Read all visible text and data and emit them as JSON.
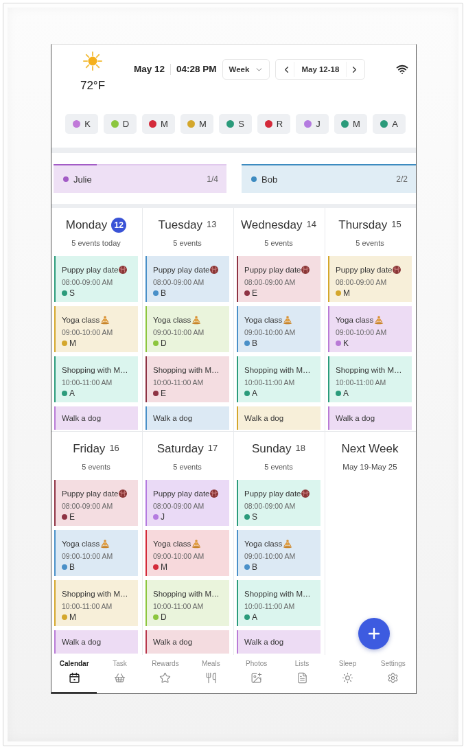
{
  "header": {
    "temperature": "72°F",
    "date": "May 12",
    "time": "04:28 PM",
    "view": "Week",
    "range": "May 12-18"
  },
  "members": [
    {
      "initial": "K",
      "color": "#c17ad9"
    },
    {
      "initial": "D",
      "color": "#8cc63e"
    },
    {
      "initial": "M",
      "color": "#d42a3a"
    },
    {
      "initial": "M",
      "color": "#d4a72c"
    },
    {
      "initial": "S",
      "color": "#2b9b7b"
    },
    {
      "initial": "R",
      "color": "#d42a3a"
    },
    {
      "initial": "J",
      "color": "#b47be0"
    },
    {
      "initial": "M",
      "color": "#2b9b7b"
    },
    {
      "initial": "A",
      "color": "#2b9b7b"
    }
  ],
  "tasks": [
    {
      "name": "Julie",
      "color": "#a35cc6",
      "count": "1/4",
      "level": 0.25
    },
    {
      "name": "Bob",
      "color": "#3d8bc0",
      "count": "2/2",
      "level": 1
    }
  ],
  "days": [
    {
      "name": "Monday",
      "date": "12",
      "selected": true,
      "summary": "5 events today",
      "events": [
        {
          "kind": "playdate",
          "title": "Puppy play date",
          "time": "08:00-09:00 AM",
          "member": "S",
          "color": "#2b9b7b"
        },
        {
          "kind": "yoga",
          "title": "Yoga class",
          "time": "09:00-10:00 AM",
          "member": "M",
          "color": "#d4a72c"
        },
        {
          "kind": "errand",
          "title": "Shopping with M…",
          "time": "10:00-11:00 AM",
          "member": "A",
          "color": "#2b9b7b"
        },
        {
          "kind": "walk",
          "title": "Walk a dog",
          "color": "#b97bd6"
        }
      ]
    },
    {
      "name": "Tuesday",
      "date": "13",
      "selected": false,
      "summary": "5 events",
      "events": [
        {
          "kind": "playdate",
          "title": "Puppy play date",
          "time": "08:00-09:00 AM",
          "member": "B",
          "color": "#4a90c8"
        },
        {
          "kind": "yoga",
          "title": "Yoga class",
          "time": "09:00-10:00 AM",
          "member": "D",
          "color": "#8cc63e"
        },
        {
          "kind": "errand",
          "title": "Shopping with M…",
          "time": "10:00-11:00 AM",
          "member": "E",
          "color": "#8e3344"
        },
        {
          "kind": "walk",
          "title": "Walk a dog",
          "color": "#4a90c8"
        }
      ]
    },
    {
      "name": "Wednesday",
      "date": "14",
      "selected": false,
      "summary": "5 events",
      "events": [
        {
          "kind": "playdate",
          "title": "Puppy play date",
          "time": "08:00-09:00 AM",
          "member": "E",
          "color": "#8e3344"
        },
        {
          "kind": "yoga",
          "title": "Yoga class",
          "time": "09:00-10:00 AM",
          "member": "B",
          "color": "#4a90c8"
        },
        {
          "kind": "errand",
          "title": "Shopping with M…",
          "time": "10:00-11:00 AM",
          "member": "A",
          "color": "#2b9b7b"
        },
        {
          "kind": "walk",
          "title": "Walk a dog",
          "color": "#d4a72c"
        }
      ]
    },
    {
      "name": "Thursday",
      "date": "15",
      "selected": false,
      "summary": "5 events",
      "events": [
        {
          "kind": "playdate",
          "title": "Puppy play date",
          "time": "08:00-09:00 AM",
          "member": "M",
          "color": "#d4a72c"
        },
        {
          "kind": "yoga",
          "title": "Yoga class",
          "time": "09:00-10:00 AM",
          "member": "K",
          "color": "#b97bd6"
        },
        {
          "kind": "errand",
          "title": "Shopping with M…",
          "time": "10:00-11:00 AM",
          "member": "A",
          "color": "#2b9b7b"
        },
        {
          "kind": "walk",
          "title": "Walk a dog",
          "color": "#b97bd6"
        }
      ]
    },
    {
      "name": "Friday",
      "date": "16",
      "selected": false,
      "summary": "5 events",
      "events": [
        {
          "kind": "playdate",
          "title": "Puppy play date",
          "time": "08:00-09:00 AM",
          "member": "E",
          "color": "#8e3344"
        },
        {
          "kind": "yoga",
          "title": "Yoga class",
          "time": "09:00-10:00 AM",
          "member": "B",
          "color": "#4a90c8"
        },
        {
          "kind": "errand",
          "title": "Shopping with M…",
          "time": "10:00-11:00 AM",
          "member": "M",
          "color": "#d4a72c"
        },
        {
          "kind": "walk",
          "title": "Walk a dog",
          "color": "#b97bd6"
        }
      ]
    },
    {
      "name": "Saturday",
      "date": "17",
      "selected": false,
      "summary": "5 events",
      "events": [
        {
          "kind": "playdate",
          "title": "Puppy play date",
          "time": "08:00-09:00 AM",
          "member": "J",
          "color": "#b47be0"
        },
        {
          "kind": "yoga",
          "title": "Yoga class",
          "time": "09:00-10:00 AM",
          "member": "M",
          "color": "#d42a3a"
        },
        {
          "kind": "errand",
          "title": "Shopping with M…",
          "time": "10:00-11:00 AM",
          "member": "D",
          "color": "#8cc63e"
        },
        {
          "kind": "walk",
          "title": "Walk a dog",
          "color": "#b8384c"
        }
      ]
    },
    {
      "name": "Sunday",
      "date": "18",
      "selected": false,
      "summary": "5 events",
      "events": [
        {
          "kind": "playdate",
          "title": "Puppy play date",
          "time": "08:00-09:00 AM",
          "member": "S",
          "color": "#2b9b7b"
        },
        {
          "kind": "yoga",
          "title": "Yoga class",
          "time": "09:00-10:00 AM",
          "member": "B",
          "color": "#4a90c8"
        },
        {
          "kind": "errand",
          "title": "Shopping with M…",
          "time": "10:00-11:00 AM",
          "member": "A",
          "color": "#2b9b7b"
        },
        {
          "kind": "walk",
          "title": "Walk a dog",
          "color": "#b97bd6"
        }
      ]
    }
  ],
  "next_week": {
    "title": "Next Week",
    "range": "May 19-May 25"
  },
  "nav": [
    {
      "label": "Calendar",
      "selected": true
    },
    {
      "label": "Task",
      "selected": false
    },
    {
      "label": "Rewards",
      "selected": false
    },
    {
      "label": "Meals",
      "selected": false
    },
    {
      "label": "Photos",
      "selected": false
    },
    {
      "label": "Lists",
      "selected": false
    },
    {
      "label": "Sleep",
      "selected": false
    },
    {
      "label": "Settings",
      "selected": false
    }
  ]
}
